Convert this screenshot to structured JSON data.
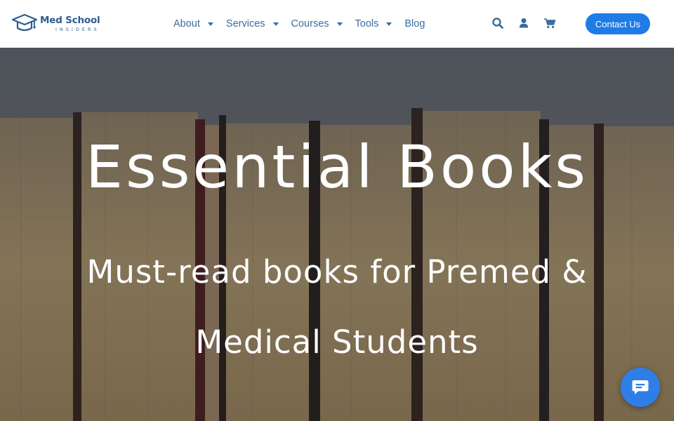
{
  "brand": {
    "name": "Med School",
    "subname": "INSIDERS"
  },
  "nav": {
    "items": [
      {
        "label": "About",
        "has_dropdown": true
      },
      {
        "label": "Services",
        "has_dropdown": true
      },
      {
        "label": "Courses",
        "has_dropdown": true
      },
      {
        "label": "Tools",
        "has_dropdown": true
      },
      {
        "label": "Blog",
        "has_dropdown": false
      }
    ],
    "icons": [
      "search-icon",
      "user-icon",
      "cart-icon"
    ],
    "cta_label": "Contact Us"
  },
  "hero": {
    "title": "Essential Books",
    "subtitle": "Must-read books for Premed & Medical Students"
  },
  "chat": {
    "icon": "chat-bubble-icon"
  },
  "colors": {
    "brand_blue": "#2c5d8f",
    "nav_text": "#3a6d9e",
    "cta_bg": "#1f7be5",
    "chat_bg": "#2f7ee8"
  }
}
